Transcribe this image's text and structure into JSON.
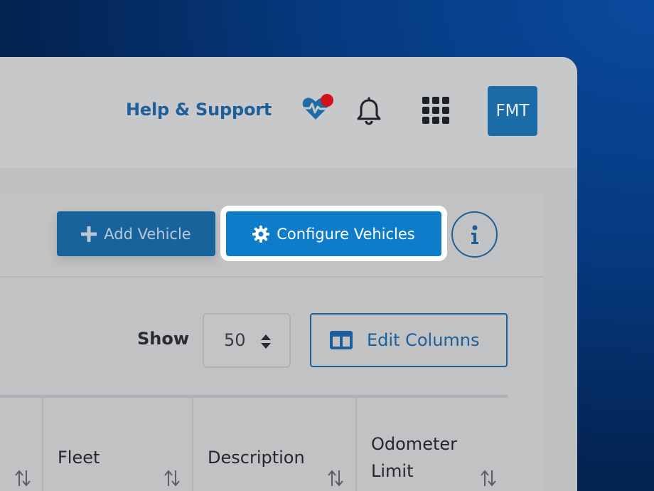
{
  "header": {
    "help_link": "Help & Support",
    "avatar_initials": "FMT",
    "icons": [
      "heart-pulse-icon",
      "bell-icon",
      "apps-grid-icon"
    ],
    "notification_dot_color": "#d0121b"
  },
  "toolbar": {
    "add_vehicle_label": "Add Vehicle",
    "configure_vehicles_label": "Configure Vehicles",
    "info_label": "i"
  },
  "table_controls": {
    "show_label": "Show",
    "page_size": "50",
    "edit_columns_label": "Edit Columns"
  },
  "table": {
    "columns": [
      {
        "label": "Fleet"
      },
      {
        "label": "Description"
      },
      {
        "label_line1": "Odometer",
        "label_line2": "Limit"
      }
    ]
  },
  "colors": {
    "brand_blue": "#1d5f98",
    "primary_button": "#0d7cc9",
    "avatar_bg": "#1a6ba6"
  }
}
